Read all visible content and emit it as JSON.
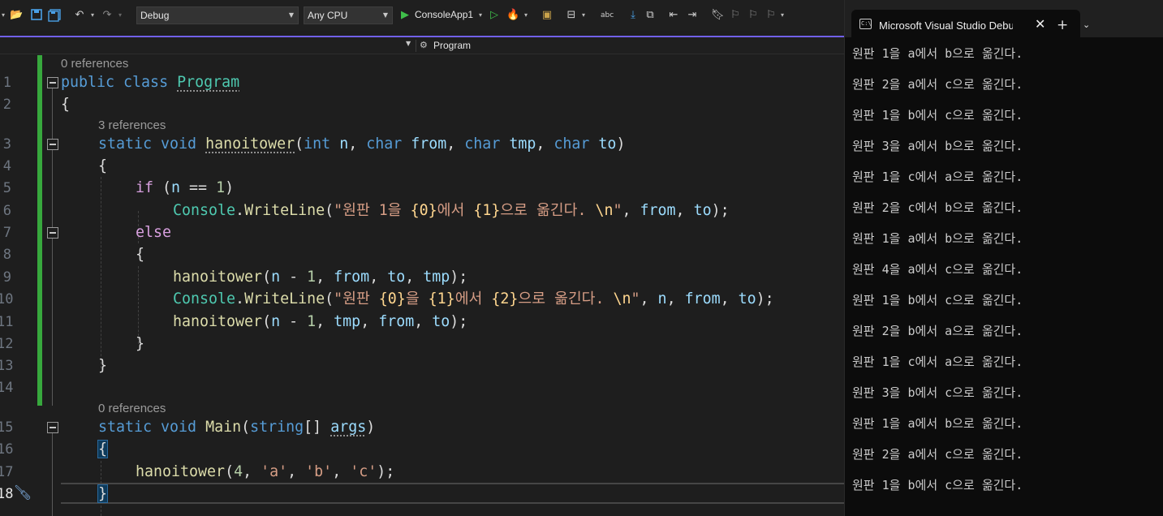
{
  "toolbar": {
    "configuration": "Debug",
    "platform": "Any CPU",
    "startup_project": "ConsoleApp1"
  },
  "navbar": {
    "member": "Program"
  },
  "editor": {
    "line_numbers": [
      "1",
      "2",
      "3",
      "4",
      "5",
      "6",
      "7",
      "8",
      "9",
      "10",
      "11",
      "12",
      "13",
      "14",
      "15",
      "16",
      "17",
      "18"
    ],
    "codelens": [
      "0 references",
      "3 references",
      "0 references"
    ],
    "code": {
      "l1_kw": "public class ",
      "l1_class": "Program",
      "l2": "{",
      "l3_kw": "static void ",
      "l3_name": "hanoitower",
      "l3_p1": "(",
      "l3_int": "int",
      "l3_n": " n",
      "l3_c1": ", ",
      "l3_char1": "char",
      "l3_from": " from",
      "l3_c2": ", ",
      "l3_char2": "char",
      "l3_tmp": " tmp",
      "l3_c3": ", ",
      "l3_char3": "char",
      "l3_to": " to",
      "l3_p2": ")",
      "l4": "{",
      "l5_if": "if",
      "l5_a": " (",
      "l5_n": "n",
      "l5_b": " == ",
      "l5_one": "1",
      "l5_c": ")",
      "l6_console": "Console",
      "l6_dot": ".",
      "l6_wl": "WriteLine",
      "l6_p": "(",
      "l6_s1": "\"원판 1을 ",
      "l6_f0": "{0}",
      "l6_s2": "에서 ",
      "l6_f1": "{1}",
      "l6_s3": "으로 옮긴다. ",
      "l6_esc": "\\n",
      "l6_s4": "\"",
      "l6_c1": ", ",
      "l6_from": "from",
      "l6_c2": ", ",
      "l6_to": "to",
      "l6_end": ");",
      "l7": "else",
      "l8": "{",
      "l9_name": "hanoitower",
      "l9_a": "(",
      "l9_n": "n",
      "l9_b": " - ",
      "l9_one": "1",
      "l9_c": ", ",
      "l9_from": "from",
      "l9_d": ", ",
      "l9_to": "to",
      "l9_e": ", ",
      "l9_tmp": "tmp",
      "l9_end": ");",
      "l10_console": "Console",
      "l10_dot": ".",
      "l10_wl": "WriteLine",
      "l10_p": "(",
      "l10_s1": "\"원판 ",
      "l10_f0": "{0}",
      "l10_s2": "을 ",
      "l10_f1": "{1}",
      "l10_s3": "에서 ",
      "l10_f2": "{2}",
      "l10_s4": "으로 옮긴다. ",
      "l10_esc": "\\n",
      "l10_s5": "\"",
      "l10_c1": ", ",
      "l10_n": "n",
      "l10_c2": ", ",
      "l10_from": "from",
      "l10_c3": ", ",
      "l10_to": "to",
      "l10_end": ");",
      "l11_name": "hanoitower",
      "l11_a": "(",
      "l11_n": "n",
      "l11_b": " - ",
      "l11_one": "1",
      "l11_c": ", ",
      "l11_tmp": "tmp",
      "l11_d": ", ",
      "l11_from": "from",
      "l11_e": ", ",
      "l11_to": "to",
      "l11_end": ");",
      "l12": "}",
      "l13": "}",
      "l15_kw": "static void ",
      "l15_name": "Main",
      "l15_a": "(",
      "l15_string": "string",
      "l15_b": "[] ",
      "l15_args": "args",
      "l15_c": ")",
      "l16": "{",
      "l17_name": "hanoitower",
      "l17_a": "(",
      "l17_four": "4",
      "l17_b": ", ",
      "l17_sa": "'a'",
      "l17_c": ", ",
      "l17_sb": "'b'",
      "l17_d": ", ",
      "l17_sc": "'c'",
      "l17_end": ");",
      "l18": "}"
    }
  },
  "terminal": {
    "tab_title": "Microsoft Visual Studio Debug",
    "tab_icon": "C:\\",
    "output": [
      "원판 1을 a에서 b으로 옮긴다.",
      "원판 2을 a에서 c으로 옮긴다.",
      "원판 1을 b에서 c으로 옮긴다.",
      "원판 3을 a에서 b으로 옮긴다.",
      "원판 1을 c에서 a으로 옮긴다.",
      "원판 2을 c에서 b으로 옮긴다.",
      "원판 1을 a에서 b으로 옮긴다.",
      "원판 4을 a에서 c으로 옮긴다.",
      "원판 1을 b에서 c으로 옮긴다.",
      "원판 2을 b에서 a으로 옮긴다.",
      "원판 1을 c에서 a으로 옮긴다.",
      "원판 3을 b에서 c으로 옮긴다.",
      "원판 1을 a에서 b으로 옮긴다.",
      "원판 2을 a에서 c으로 옮긴다.",
      "원판 1을 b에서 c으로 옮긴다."
    ]
  },
  "colors": {
    "keyword": "#569cd6",
    "control": "#d8a0df",
    "type": "#4ec9b0",
    "method": "#dcdcaa",
    "parameter": "#9cdcfe",
    "string": "#d69d85",
    "number": "#b5cea8",
    "change_bar": "#37a83d",
    "accent": "#7160e8"
  },
  "icons": [
    "new-project-icon",
    "open-folder-icon",
    "save-icon",
    "save-all-icon",
    "undo-icon",
    "redo-icon",
    "start-debugging-icon",
    "start-without-debugging-icon",
    "hot-reload-icon",
    "solution-explorer-icon",
    "bookmark-icon",
    "class-icon",
    "terminal-icon",
    "close-icon",
    "new-tab-icon",
    "dropdown-icon",
    "quick-actions-screwdriver-icon"
  ]
}
